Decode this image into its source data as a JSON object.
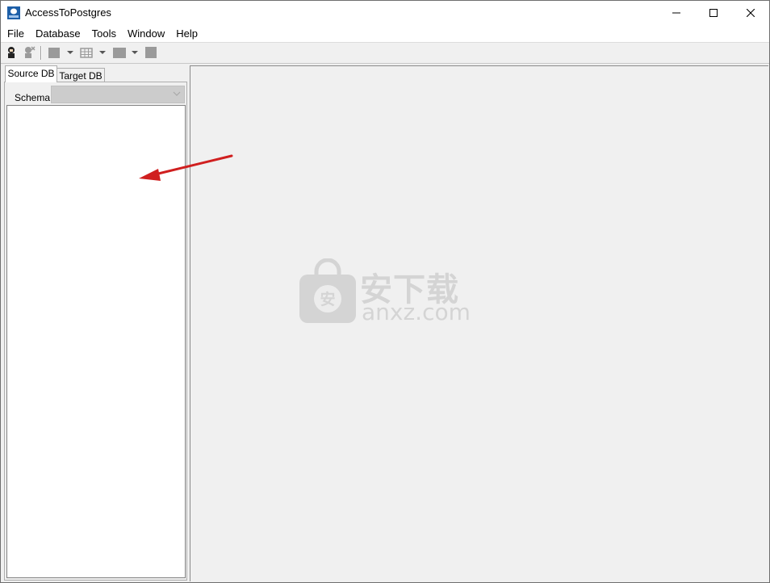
{
  "window": {
    "title": "AccessToPostgres"
  },
  "menu": [
    "File",
    "Database",
    "Tools",
    "Window",
    "Help"
  ],
  "toolbar": {
    "icons": [
      "connect-icon",
      "disconnect-icon",
      "new-icon",
      "dropdown-arrow",
      "table-icon",
      "dropdown-arrow",
      "grid-icon",
      "dropdown-arrow",
      "stop-icon"
    ]
  },
  "left_panel": {
    "tabs": [
      {
        "label": "Source DB",
        "active": true
      },
      {
        "label": "Target DB",
        "active": false
      }
    ],
    "schema_label": "Schema",
    "schema_value": ""
  },
  "watermark": {
    "cn": "安下载",
    "en": "anxz.com",
    "badge": "安"
  },
  "colors": {
    "arrow": "#d01f1f",
    "watermark": "#d4d4d4",
    "background": "#f0f0f0"
  }
}
